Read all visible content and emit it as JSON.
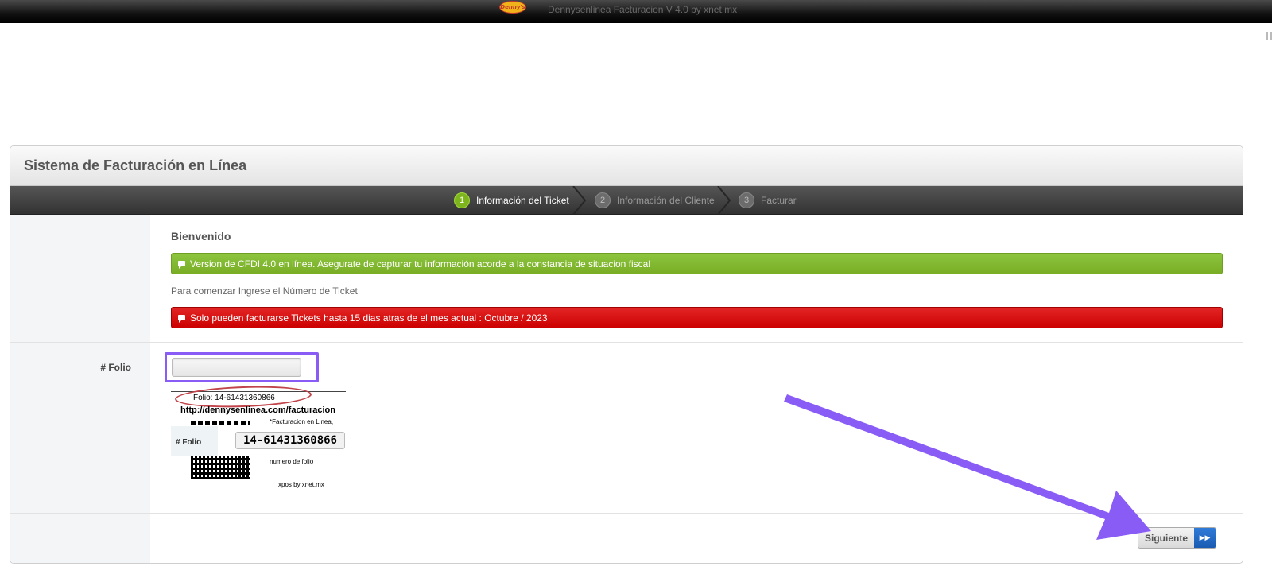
{
  "topbar": {
    "logo_text": "Denny's",
    "title": "Dennysenlinea Facturacion V 4.0 by xnet.mx"
  },
  "panel": {
    "title": "Sistema de Facturación en Línea"
  },
  "wizard": {
    "steps": [
      {
        "number": "1",
        "label": "Información del Ticket",
        "active": true
      },
      {
        "number": "2",
        "label": "Información del Cliente",
        "active": false
      },
      {
        "number": "3",
        "label": "Facturar",
        "active": false
      }
    ]
  },
  "intro": {
    "welcome": "Bienvenido",
    "cfdi_notice": "Version de CFDI 4.0 en línea. Asegurate de capturar tu información acorde a la constancia de situacion fiscal",
    "hint": "Para comenzar Ingrese el Número de Ticket",
    "limit_notice": "Solo pueden facturarse Tickets hasta 15 dias atras de el mes actual : Octubre / 2023"
  },
  "form": {
    "folio_label": "# Folio",
    "folio_value": "",
    "folio_placeholder": ""
  },
  "ticket_example": {
    "folio_line": "Folio: 14-61431360866",
    "url": "http://dennysenlinea.com/facturacion",
    "facturacion_text": "*Facturacion en Linea,",
    "folio_label": "# Folio",
    "folio_number": "14-61431360866",
    "numero_text": "numero de folio",
    "footer": "xpos by xnet.mx"
  },
  "actions": {
    "next_label": "Siguiente",
    "next_icon": "fast-forward-icon"
  },
  "colors": {
    "accent_green": "#8dc63f",
    "alert_red": "#dd0000",
    "annotation_purple": "#8a5cf6",
    "button_blue": "#1f66c4"
  }
}
